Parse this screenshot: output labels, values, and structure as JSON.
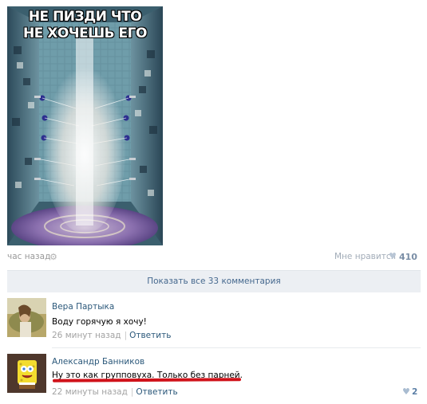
{
  "post": {
    "image": {
      "caption_line1": "НЕ ПИЗДИ ЧТО",
      "caption_line2": "НЕ ХОЧЕШЬ ЕГО"
    },
    "time": "час назад",
    "gear_icon": "gear-icon",
    "like_label": "Мне нравится",
    "like_count": "410",
    "like_icon": "heart-icon"
  },
  "show_all_comments": "Показать все 33 комментария",
  "comments": [
    {
      "author": "Вера Партыка",
      "text": "Воду горячую я хочу!",
      "time": "26 минут назад",
      "separator": "|",
      "reply": "Ответить"
    },
    {
      "author": "Александр Банников",
      "text": "Ну это как групповуха. Только без парней.",
      "time": "22 минуты назад",
      "separator": "|",
      "reply": "Ответить",
      "like_count": "2",
      "like_icon": "heart-icon"
    }
  ],
  "colors": {
    "link": "#2b587a",
    "muted": "#a3a3a3",
    "bar_bg": "#eceff3",
    "highlight": "#d0121a"
  }
}
